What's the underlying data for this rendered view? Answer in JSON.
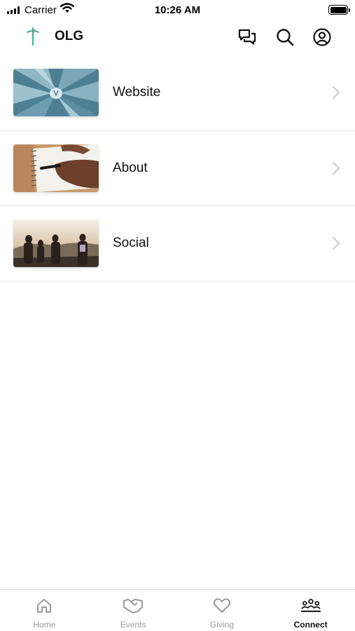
{
  "status_bar": {
    "carrier": "Carrier",
    "time": "10:26 AM"
  },
  "header": {
    "title": "OLG",
    "icons": [
      "logo-cross-icon",
      "chat-icon",
      "search-icon",
      "profile-icon"
    ]
  },
  "items": [
    {
      "label": "Website",
      "thumbnail": "agave-plant-image"
    },
    {
      "label": "About",
      "thumbnail": "notebook-writing-image"
    },
    {
      "label": "Social",
      "thumbnail": "friends-sunset-image"
    }
  ],
  "tabs": [
    {
      "label": "Home",
      "icon": "home-icon",
      "active": false
    },
    {
      "label": "Events",
      "icon": "handshake-icon",
      "active": false
    },
    {
      "label": "Giving",
      "icon": "heart-icon",
      "active": false
    },
    {
      "label": "Connect",
      "icon": "group-icon",
      "active": true
    }
  ],
  "colors": {
    "text": "#111111",
    "inactive_tab": "#9a9a9a",
    "divider": "#e6e6e6",
    "chevron": "#c4c4c4",
    "logo_teal": "#2bb5a5",
    "logo_coral": "#e8756a"
  }
}
